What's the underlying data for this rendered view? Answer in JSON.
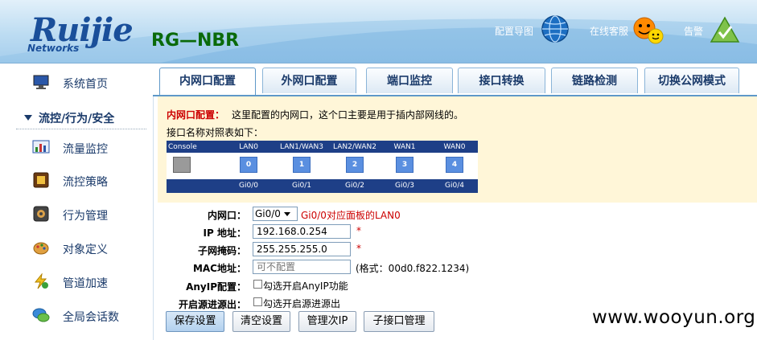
{
  "header": {
    "logo": "Ruijie",
    "logo_sub": "Networks",
    "model": "RG—NBR",
    "links": [
      "配置导图",
      "在线客服",
      "告警"
    ]
  },
  "sidebar": {
    "items_top": [
      {
        "label": "系统首页",
        "icon": "monitor-icon"
      }
    ],
    "group": "流控/行为/安全",
    "items": [
      {
        "label": "流量监控",
        "icon": "chart-icon"
      },
      {
        "label": "流控策略",
        "icon": "policy-icon"
      },
      {
        "label": "行为管理",
        "icon": "behavior-icon"
      },
      {
        "label": "对象定义",
        "icon": "object-icon"
      },
      {
        "label": "管道加速",
        "icon": "lightning-icon"
      },
      {
        "label": "全局会话数",
        "icon": "chat-icon"
      }
    ]
  },
  "tabs": [
    "内网口配置",
    "外网口配置",
    "端口监控",
    "接口转换",
    "链路检测",
    "切换公网模式"
  ],
  "note": {
    "title": "内网口配置：",
    "text": "这里配置的内网口，这个口主要是用于插内部网线的。",
    "sub": "接口名称对照表如下："
  },
  "ports": {
    "top_labels": [
      "Console",
      "LAN0",
      "LAN1/WAN3",
      "LAN2/WAN2",
      "WAN1",
      "WAN0"
    ],
    "numbers": [
      "",
      "0",
      "1",
      "2",
      "3",
      "4"
    ],
    "bottom_labels": [
      "Gi0/0",
      "Gi0/1",
      "Gi0/2",
      "Gi0/3",
      "Gi0/4"
    ]
  },
  "form": {
    "lan_label": "内网口：",
    "lan_value": "Gi0/0",
    "lan_hint": "Gi0/0对应面板的LAN0",
    "ip_label": "IP 地址：",
    "ip_value": "192.168.0.254",
    "mask_label": "子网掩码：",
    "mask_value": "255.255.255.0",
    "mac_label": "MAC地址：",
    "mac_placeholder": "可不配置",
    "mac_hint": "(格式：00d0.f822.1234)",
    "anyip_label": "AnyIP配置：",
    "anyip_text": "勾选开启AnyIP功能",
    "src_label": "开启源进源出：",
    "src_text": "勾选开启源进源出",
    "required_mark": "*"
  },
  "buttons": [
    "保存设置",
    "清空设置",
    "管理次IP",
    "子接口管理"
  ],
  "watermark": "www.wooyun.org"
}
